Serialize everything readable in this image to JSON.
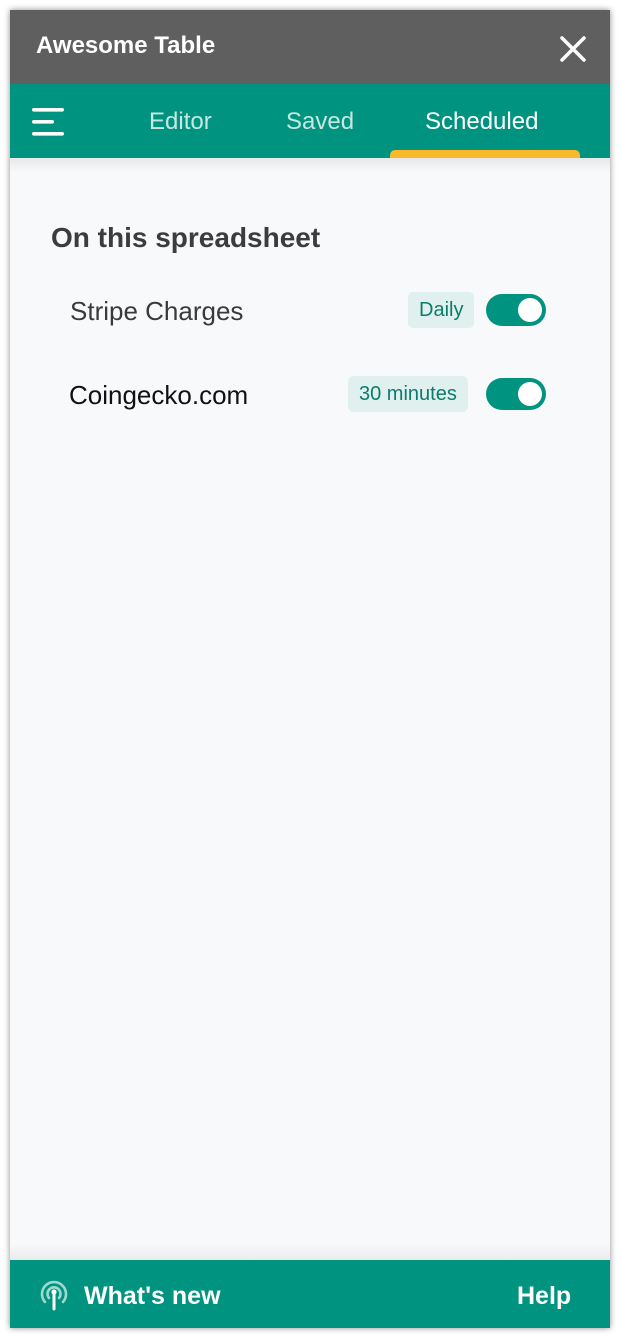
{
  "header": {
    "title": "Awesome Table",
    "close_icon": "close-icon"
  },
  "tabs": {
    "menu_icon": "hamburger-menu-icon",
    "items": [
      {
        "label": "Editor",
        "active": false
      },
      {
        "label": "Saved",
        "active": false
      },
      {
        "label": "Scheduled",
        "active": true
      }
    ],
    "indicator_color": "#f9b92b"
  },
  "main": {
    "section_title": "On this spreadsheet",
    "schedules": [
      {
        "name": "Stripe Charges",
        "frequency": "Daily",
        "enabled": true
      },
      {
        "name": "Coingecko.com",
        "frequency": "30 minutes",
        "enabled": true
      }
    ]
  },
  "footer": {
    "whats_new_icon": "broadcast-icon",
    "whats_new_label": "What's new",
    "help_label": "Help"
  },
  "colors": {
    "title_bar": "#5f5f5f",
    "brand_teal": "#00937f",
    "badge_bg": "#e0f0ee",
    "badge_text": "#0b7c6c",
    "page_bg": "#f8f9fb"
  }
}
